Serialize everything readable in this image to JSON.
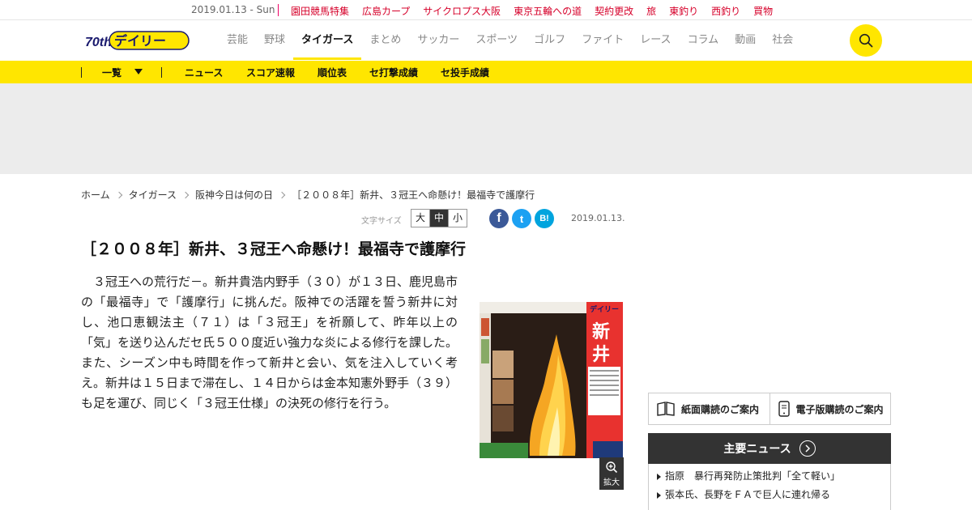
{
  "topbar": {
    "date": "2019.01.13 - Sun",
    "links": [
      "園田競馬特集",
      "広島カープ",
      "サイクロプス大阪",
      "東京五輪への道",
      "契約更改",
      "旅",
      "東釣り",
      "西釣り",
      "買物"
    ]
  },
  "header": {
    "logo_text": "デイリー",
    "logo_badge": "70th",
    "nav": [
      "芸能",
      "野球",
      "タイガース",
      "まとめ",
      "サッカー",
      "スポーツ",
      "ゴルフ",
      "ファイト",
      "レース",
      "コラム",
      "動画",
      "社会"
    ],
    "nav_active": "タイガース"
  },
  "subnav": {
    "list_label": "一覧",
    "items": [
      "ニュース",
      "スコア速報",
      "順位表",
      "セ打撃成績",
      "セ投手成績"
    ]
  },
  "breadcrumb": [
    "ホーム",
    "タイガース",
    "阪神今日は何の日",
    "［２００８年］新井、３冠王へ命懸け！最福寺で護摩行"
  ],
  "font_size": {
    "label": "文字サイズ",
    "options": [
      "大",
      "中",
      "小"
    ],
    "selected": "中"
  },
  "share": {
    "facebook": "f",
    "twitter": "t",
    "hatena": "B!"
  },
  "article": {
    "date": "2019.01.13.",
    "title": "［２００８年］新井、３冠王へ命懸け！最福寺で護摩行",
    "body": "３冠王への荒行だ－。新井貴浩内野手（３０）が１３日、鹿児島市の「最福寺」で「護摩行」に挑んだ。阪神での活躍を誓う新井に対し、池口恵観法主（７１）は「３冠王」を祈願して、昨年以上の「気」を送り込んだセ氏５００度近い強力な炎による修行を課した。また、シーズン中も時間を作って新井と会い、気を注入していく考え。新井は１５日まで滞在し、１４日からは金本知憲外野手（３９）も足を運び、同じく「３冠王仕様」の決死の修行を行う。",
    "zoom_label": "拡大"
  },
  "sidebar": {
    "paper_subscription": "紙面購読のご案内",
    "digital_subscription": "電子版購読のご案内",
    "main_news_title": "主要ニュース",
    "main_news": [
      "指原　暴行再発防止策批判「全て軽い」",
      "張本氏、長野をＦＡで巨人に連れ帰る"
    ]
  },
  "colors": {
    "accent_yellow": "#ffe600",
    "link_red": "#d6002a",
    "facebook": "#3b5998",
    "twitter": "#1da1f2",
    "hatena": "#00a4de"
  }
}
